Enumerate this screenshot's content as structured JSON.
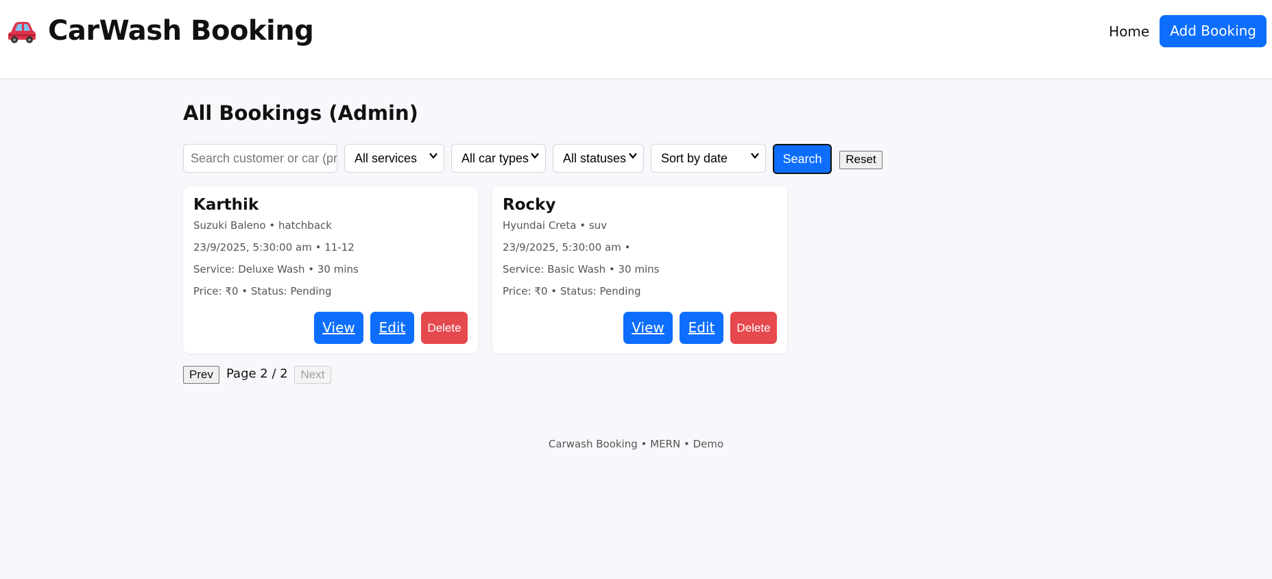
{
  "header": {
    "brand_title": "CarWash Booking",
    "brand_icon": "car-icon",
    "nav_home": "Home",
    "nav_add_booking": "Add Booking"
  },
  "main": {
    "title": "All Bookings (Admin)",
    "filters": {
      "search_placeholder": "Search customer or car (pre",
      "service_select": "All services",
      "car_type_select": "All car types",
      "status_select": "All statuses",
      "sort_select": "Sort by date",
      "search_button": "Search",
      "reset_button": "Reset"
    },
    "bookings": [
      {
        "name": "Karthik",
        "car": "Suzuki Baleno • hatchback",
        "datetime": "23/9/2025, 5:30:00 am • 11-12",
        "service": "Service: Deluxe Wash • 30 mins",
        "price_status": "Price: ₹0 • Status: Pending",
        "view": "View",
        "edit": "Edit",
        "delete": "Delete"
      },
      {
        "name": "Rocky",
        "car": "Hyundai Creta • suv",
        "datetime": "23/9/2025, 5:30:00 am •",
        "service": "Service: Basic Wash • 30 mins",
        "price_status": "Price: ₹0 • Status: Pending",
        "view": "View",
        "edit": "Edit",
        "delete": "Delete"
      }
    ],
    "pagination": {
      "prev": "Prev",
      "label": "Page 2 / 2",
      "next": "Next"
    }
  },
  "footer": {
    "text": "Carwash Booking • MERN • Demo"
  },
  "colors": {
    "primary": "#0d6efd",
    "danger": "#e5484d",
    "background": "#f7f8fb"
  }
}
